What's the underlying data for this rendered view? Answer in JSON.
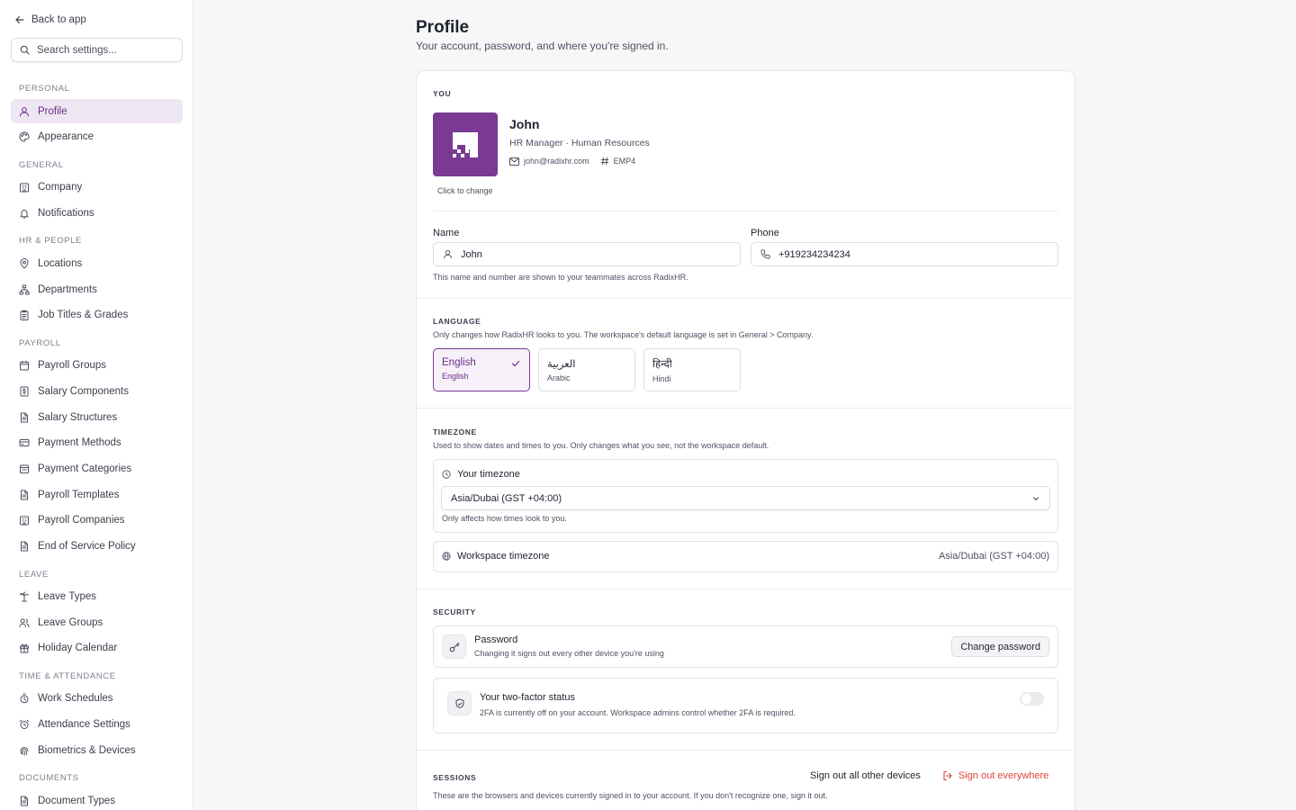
{
  "sidebar": {
    "back_label": "Back to app",
    "search_placeholder": "Search settings...",
    "sections": [
      {
        "title": "PERSONAL",
        "items": [
          {
            "label": "Profile",
            "icon": "user-icon",
            "active": true
          },
          {
            "label": "Appearance",
            "icon": "palette-icon"
          }
        ]
      },
      {
        "title": "GENERAL",
        "items": [
          {
            "label": "Company",
            "icon": "building-icon"
          },
          {
            "label": "Notifications",
            "icon": "bell-icon"
          }
        ]
      },
      {
        "title": "HR & PEOPLE",
        "items": [
          {
            "label": "Locations",
            "icon": "map-pin-icon"
          },
          {
            "label": "Departments",
            "icon": "org-chart-icon"
          },
          {
            "label": "Job Titles & Grades",
            "icon": "clipboard-icon"
          }
        ]
      },
      {
        "title": "PAYROLL",
        "items": [
          {
            "label": "Payroll Groups",
            "icon": "calendar-icon"
          },
          {
            "label": "Salary Components",
            "icon": "dollar-doc-icon"
          },
          {
            "label": "Salary Structures",
            "icon": "document-icon"
          },
          {
            "label": "Payment Methods",
            "icon": "credit-card-icon"
          },
          {
            "label": "Payment Categories",
            "icon": "folder-icon"
          },
          {
            "label": "Payroll Templates",
            "icon": "document-icon"
          },
          {
            "label": "Payroll Companies",
            "icon": "building-icon"
          },
          {
            "label": "End of Service Policy",
            "icon": "document-icon"
          }
        ]
      },
      {
        "title": "LEAVE",
        "items": [
          {
            "label": "Leave Types",
            "icon": "palm-tree-icon"
          },
          {
            "label": "Leave Groups",
            "icon": "users-icon"
          },
          {
            "label": "Holiday Calendar",
            "icon": "gift-icon"
          }
        ]
      },
      {
        "title": "TIME & ATTENDANCE",
        "items": [
          {
            "label": "Work Schedules",
            "icon": "timer-icon"
          },
          {
            "label": "Attendance Settings",
            "icon": "alarm-clock-icon"
          },
          {
            "label": "Biometrics & Devices",
            "icon": "fingerprint-icon"
          }
        ]
      },
      {
        "title": "DOCUMENTS",
        "items": [
          {
            "label": "Document Types",
            "icon": "document-icon"
          }
        ]
      }
    ]
  },
  "page": {
    "title": "Profile",
    "subtitle": "Your account, password, and where you're signed in."
  },
  "you": {
    "section_label": "YOU",
    "avatar_hint": "Click to change",
    "name": "John",
    "role": "HR Manager · Human Resources",
    "email": "john@radixhr.com",
    "employee_id": "EMP4",
    "name_label": "Name",
    "name_value": "John",
    "phone_label": "Phone",
    "phone_value": "+919234234234",
    "help": "This name and number are shown to your teammates across RadixHR."
  },
  "language": {
    "section_label": "LANGUAGE",
    "description": "Only changes how RadixHR looks to you. The workspace's default language is set in General > Company.",
    "options": [
      {
        "native": "English",
        "english": "English",
        "selected": true
      },
      {
        "native": "العربية",
        "english": "Arabic",
        "selected": false
      },
      {
        "native": "हिन्दी",
        "english": "Hindi",
        "selected": false
      }
    ]
  },
  "timezone": {
    "section_label": "TIMEZONE",
    "description": "Used to show dates and times to you. Only changes what you see, not the workspace default.",
    "your_label": "Your timezone",
    "your_value": "Asia/Dubai (GST +04:00)",
    "your_help": "Only affects how times look to you.",
    "workspace_label": "Workspace timezone",
    "workspace_value": "Asia/Dubai (GST +04:00)"
  },
  "security": {
    "section_label": "SECURITY",
    "password_title": "Password",
    "password_desc": "Changing it signs out every other device you're using",
    "change_password_label": "Change password",
    "twofa_title": "Your two-factor status",
    "twofa_desc": "2FA is currently off on your account. Workspace admins control whether 2FA is required.",
    "twofa_enabled": false
  },
  "sessions": {
    "section_label": "SESSIONS",
    "sign_out_others_label": "Sign out all other devices",
    "sign_out_everywhere_label": "Sign out everywhere",
    "description": "These are the browsers and devices currently signed in to your account. If you don't recognize one, sign it out."
  },
  "colors": {
    "accent": "#7a3a93",
    "accent_text": "#6d2b86",
    "danger": "#e0433a"
  }
}
